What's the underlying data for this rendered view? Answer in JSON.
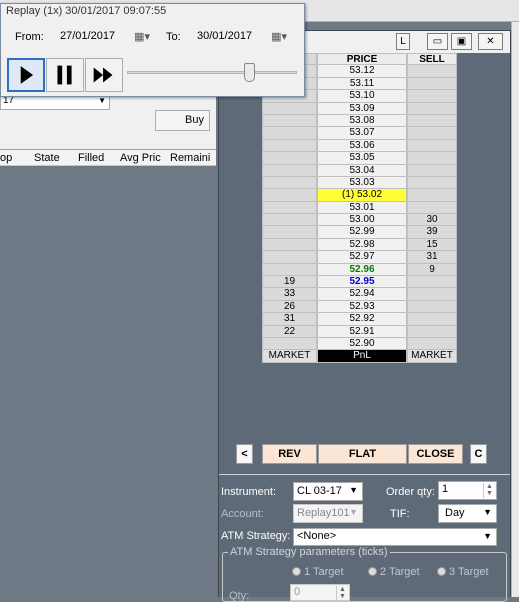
{
  "replay": {
    "title": "Replay (1x) 30/01/2017 09:07:55",
    "from_label": "From:",
    "from_date": "27/01/2017",
    "to_label": "To:",
    "to_date": "30/01/2017",
    "speed_position": 0.72
  },
  "background": {
    "buy_label": "Buy",
    "combo_value": "17",
    "order_columns": [
      "op",
      "State",
      "Filled",
      "Avg Pric",
      "Remaini"
    ]
  },
  "dom": {
    "l_button": "L",
    "headers": {
      "buy": "",
      "price": "PRICE",
      "sell": "SELL"
    },
    "rows": [
      {
        "buy": "",
        "price": "53.12",
        "sell": ""
      },
      {
        "buy": "",
        "price": "53.11",
        "sell": ""
      },
      {
        "buy": "",
        "price": "53.10",
        "sell": ""
      },
      {
        "buy": "",
        "price": "53.09",
        "sell": ""
      },
      {
        "buy": "",
        "price": "53.08",
        "sell": ""
      },
      {
        "buy": "",
        "price": "53.07",
        "sell": ""
      },
      {
        "buy": "",
        "price": "53.06",
        "sell": ""
      },
      {
        "buy": "",
        "price": "53.05",
        "sell": ""
      },
      {
        "buy": "",
        "price": "53.04",
        "sell": ""
      },
      {
        "buy": "",
        "price": "53.03",
        "sell": ""
      },
      {
        "buy": "",
        "price": "(1) 53.02",
        "sell": "",
        "style": "last"
      },
      {
        "buy": "",
        "price": "53.01",
        "sell": ""
      },
      {
        "buy": "",
        "price": "53.00",
        "sell": "30"
      },
      {
        "buy": "",
        "price": "52.99",
        "sell": "39"
      },
      {
        "buy": "",
        "price": "52.98",
        "sell": "15"
      },
      {
        "buy": "",
        "price": "52.97",
        "sell": "31"
      },
      {
        "buy": "",
        "price": "52.96",
        "sell": "9",
        "style": "ask"
      },
      {
        "buy": "19",
        "price": "52.95",
        "sell": "",
        "style": "bid"
      },
      {
        "buy": "33",
        "price": "52.94",
        "sell": ""
      },
      {
        "buy": "26",
        "price": "52.93",
        "sell": ""
      },
      {
        "buy": "31",
        "price": "52.92",
        "sell": ""
      },
      {
        "buy": "22",
        "price": "52.91",
        "sell": ""
      },
      {
        "buy": "",
        "price": "52.90",
        "sell": ""
      }
    ],
    "footer": {
      "buy": "MARKET",
      "price": "PnL",
      "sell": "MARKET"
    },
    "actions": {
      "prev": "<",
      "rev": "REV",
      "flat": "FLAT",
      "close": "CLOSE",
      "c": "C"
    }
  },
  "form": {
    "instrument_label": "Instrument:",
    "instrument_value": "CL 03-17",
    "order_qty_label": "Order qty:",
    "order_qty_value": "1",
    "account_label": "Account:",
    "account_value": "Replay101",
    "tif_label": "TIF:",
    "tif_value": "Day",
    "atm_label": "ATM Strategy:",
    "atm_value": "<None>",
    "atm_params_label": "ATM Strategy parameters (ticks)",
    "targets": [
      "1 Target",
      "2 Target",
      "3 Target"
    ],
    "qty_label": "Qty:",
    "qty_value": "0"
  },
  "colors": {
    "last_price": "#ffff33",
    "ask_price": "#0a7a0a",
    "bid_price": "#0000cc",
    "action_button": "#fbe6d5"
  }
}
